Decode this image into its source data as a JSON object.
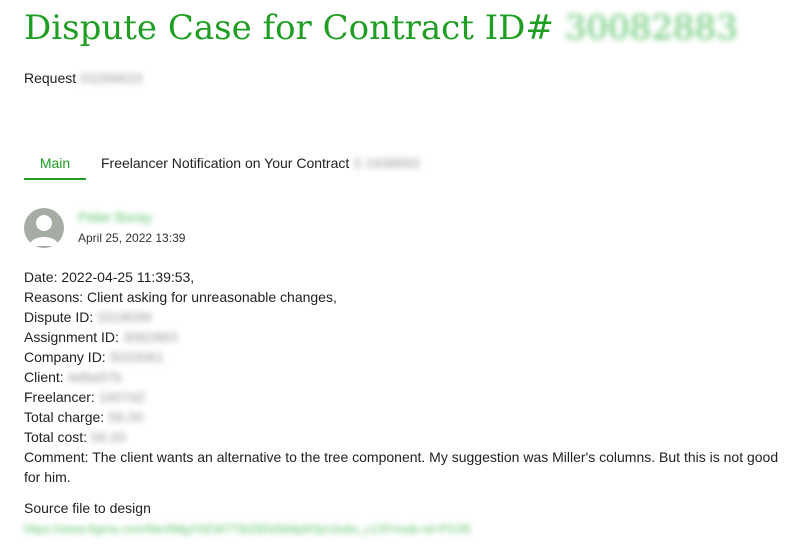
{
  "header": {
    "title": "Dispute Case for Contract ID#",
    "title_id": "30082883",
    "request_label": "Request",
    "request_id": "03266633"
  },
  "tabs": [
    {
      "label": "Main",
      "active": true
    },
    {
      "label": "Freelancer Notification on Your Contract",
      "suffix": "3 1938893"
    }
  ],
  "post": {
    "author": "Peter Boray",
    "timestamp": "April 25, 2022 13:39"
  },
  "details": {
    "date": "Date: 2022-04-25 11:39:53,",
    "reasons": "Reasons: Client asking for unreasonable changes,",
    "dispute_id_label": "Dispute ID:",
    "dispute_id_value": "3318099",
    "assignment_id_label": "Assignment ID:",
    "assignment_id_value": "3082883",
    "company_id_label": "Company ID:",
    "company_id_value": "5033061",
    "client_label": "Client:",
    "client_value": "4d6a97b",
    "freelancer_label": "Freelancer:",
    "freelancer_value": "1607d2",
    "total_charge_label": "Total charge:",
    "total_charge_value": "56.00",
    "total_cost_label": "Total cost:",
    "total_cost_value": "56.00",
    "comment": "Comment: The client wants an alternative to the tree component. My suggestion was Miller's columns. But this is not good for him."
  },
  "source": {
    "label": "Source file to design",
    "link": "https://www.figma.com/file/4MgXSEW7T8iZ8Dd3b6pK0jcUlubs_c1XFnode-id=PG35"
  },
  "colors": {
    "accent": "#1e9e22",
    "blurred_link": "#5cc46a",
    "avatar": "#a4aca4"
  }
}
